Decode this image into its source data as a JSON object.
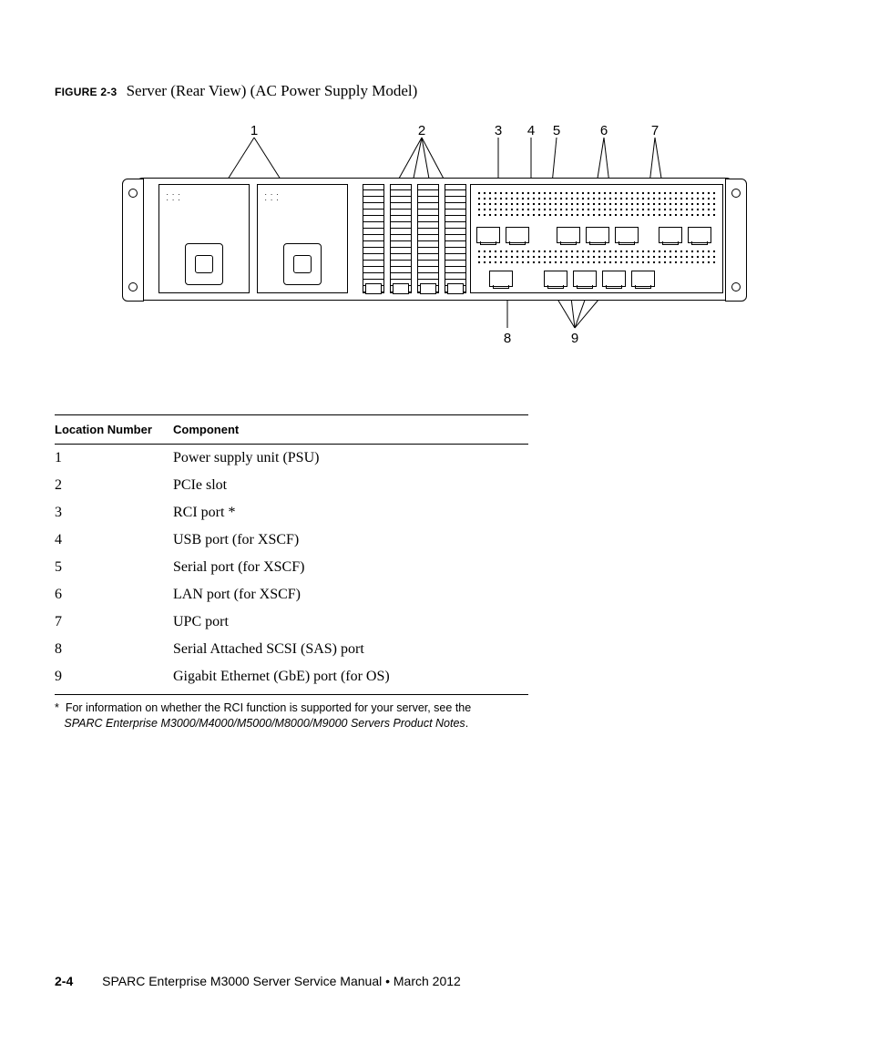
{
  "figure": {
    "label": "FIGURE 2-3",
    "title": "Server (Rear View) (AC Power Supply Model)"
  },
  "callouts_top": [
    "1",
    "2",
    "3",
    "4",
    "5",
    "6",
    "7"
  ],
  "callouts_bottom": [
    "8",
    "9"
  ],
  "table": {
    "headers": [
      "Location Number",
      "Component"
    ],
    "rows": [
      {
        "num": "1",
        "comp": "Power supply unit (PSU)"
      },
      {
        "num": "2",
        "comp": "PCIe slot"
      },
      {
        "num": "3",
        "comp": "RCI port *"
      },
      {
        "num": "4",
        "comp": "USB port (for XSCF)"
      },
      {
        "num": "5",
        "comp": "Serial port (for XSCF)"
      },
      {
        "num": "6",
        "comp": "LAN port (for XSCF)"
      },
      {
        "num": "7",
        "comp": "UPC port"
      },
      {
        "num": "8",
        "comp": "Serial Attached SCSI (SAS) port"
      },
      {
        "num": "9",
        "comp": "Gigabit Ethernet (GbE) port (for OS)"
      }
    ]
  },
  "footnote": {
    "marker": "*",
    "line1": "For information on whether the RCI function is supported for your server, see the",
    "line2_ital": "SPARC Enterprise M3000/M4000/M5000/M8000/M9000 Servers Product Notes",
    "line2_tail": "."
  },
  "footer": {
    "page": "2-4",
    "text": "SPARC Enterprise M3000 Server Service Manual  •  March 2012"
  }
}
